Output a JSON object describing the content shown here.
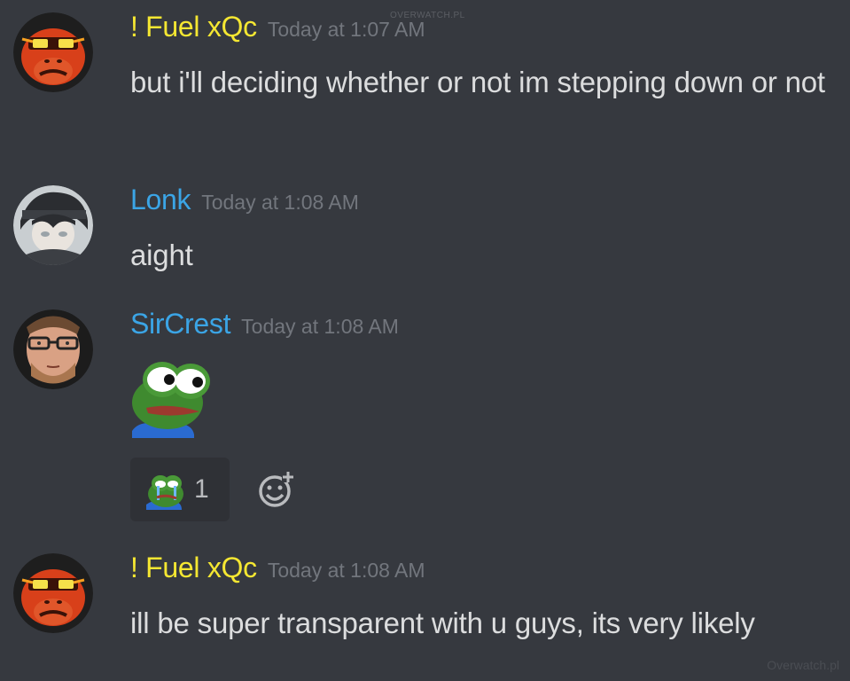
{
  "messages": [
    {
      "username": "! Fuel xQc",
      "username_color": "#f5e732",
      "timestamp": "Today at 1:07 AM",
      "text": "but i'll deciding whether or not im stepping down or not",
      "avatar": "ape-avatar-icon"
    },
    {
      "username": "Lonk",
      "username_color": "#3ba5e6",
      "timestamp": "Today at 1:08 AM",
      "text": "aight",
      "avatar": "anime-avatar-icon"
    },
    {
      "username": "SirCrest",
      "username_color": "#3ba5e6",
      "timestamp": "Today at 1:08 AM",
      "emote": "pepe-wide-eyes-emote",
      "avatar": "glasses-man-avatar-icon",
      "reaction": {
        "emote": "pepe-crying-emote",
        "count": "1"
      }
    },
    {
      "username": "! Fuel xQc",
      "username_color": "#f5e732",
      "timestamp": "Today at 1:08 AM",
      "text": "ill be super transparent with u guys, its very likely",
      "avatar": "ape-avatar-icon"
    }
  ],
  "watermarks": {
    "top": "OVERWATCH.PL",
    "bottom": "Overwatch.pl"
  },
  "colors": {
    "background": "#36393f",
    "text": "#dcddde",
    "timestamp": "#72767d",
    "reaction_bg": "#2f3136"
  }
}
